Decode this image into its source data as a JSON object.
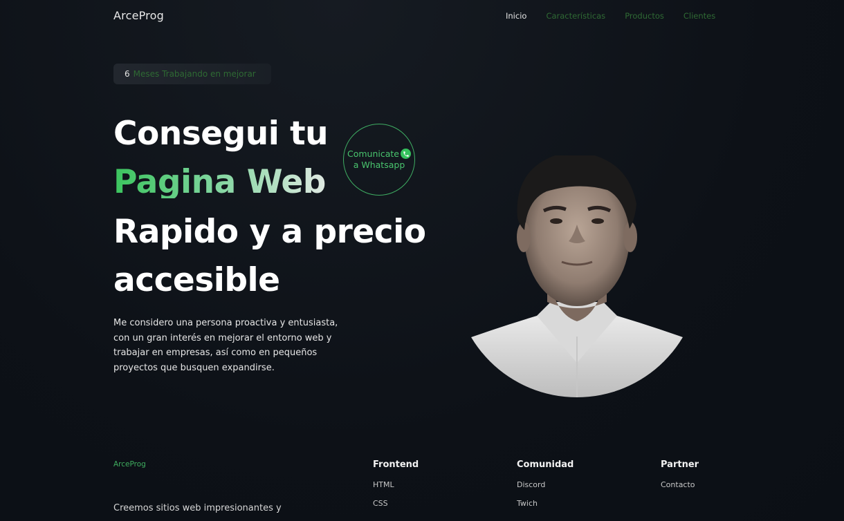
{
  "brand": "ArceProg",
  "nav": [
    "Inicio",
    "Características",
    "Productos",
    "Clientes"
  ],
  "badge": {
    "number": "6",
    "text": "Meses Trabajando en mejorar"
  },
  "hero": {
    "line1": "Consegui tu",
    "line2": "Pagina Web",
    "line3": "Rapido y a precio",
    "line4": "accesible"
  },
  "whatsapp": {
    "line1": "Comunicate",
    "line2": "a Whatsapp"
  },
  "description": "Me considero una persona proactiva y entusiasta, con un gran interés en mejorar el entorno web y trabajar en empresas, así como en pequeños proyectos que busquen expandirse.",
  "footer": {
    "brand": "ArceProg",
    "tagline": "Creemos sitios web impresionantes y",
    "columns": [
      {
        "title": "Frontend",
        "links": [
          "HTML",
          "CSS"
        ]
      },
      {
        "title": "Comunidad",
        "links": [
          "Discord",
          "Twich"
        ]
      },
      {
        "title": "Partner",
        "links": [
          "Contacto"
        ]
      }
    ]
  },
  "colors": {
    "background": "#0d1117",
    "accent_green": "#3bc45e",
    "nav_inactive": "#2f6a34"
  }
}
